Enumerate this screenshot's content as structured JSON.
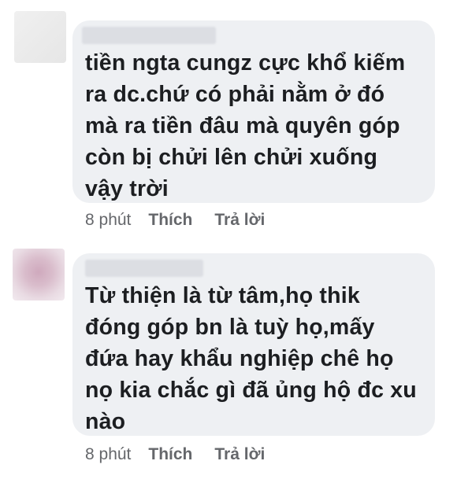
{
  "comments": [
    {
      "text_lines": [
        "tiền ngta cungz cực khổ kiếm",
        "ra dc.chứ có phải nằm ở đó",
        "mà ra tiền đâu mà quyên góp",
        "còn bị chửi lên chửi xuống",
        "vậy trời"
      ],
      "time": "8 phút",
      "like_label": "Thích",
      "reply_label": "Trả lời"
    },
    {
      "text_lines": [
        "Từ thiện là từ tâm,họ thik",
        "đóng góp bn là tuỳ họ,mấy",
        "đứa hay khẩu nghiệp chê họ",
        "nọ kia chắc gì đã ủng hộ đc xu",
        "nào"
      ],
      "time": "8 phút",
      "like_label": "Thích",
      "reply_label": "Trả lời"
    }
  ],
  "colors": {
    "bubble": "#eef0f3",
    "text": "#1c1e21",
    "meta": "#65676b"
  }
}
